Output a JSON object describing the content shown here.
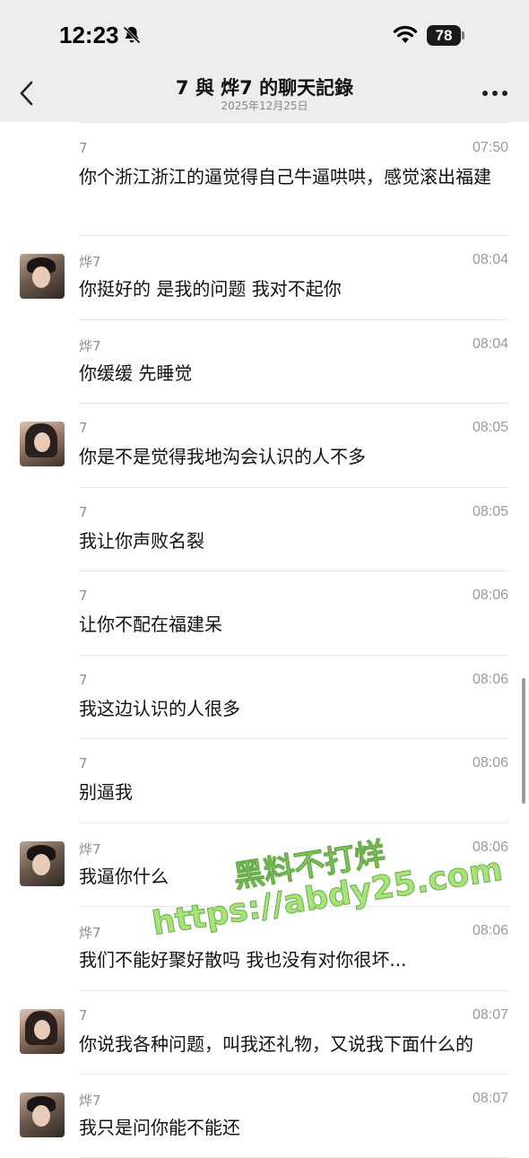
{
  "status_bar": {
    "time": "12:23",
    "battery": "78",
    "icons": [
      "bell-slash-icon",
      "wifi-icon",
      "battery-icon"
    ]
  },
  "header": {
    "title": "7 與 烨7 的聊天記錄",
    "date": "2025年12月25日",
    "icons": [
      "chevron-left-icon",
      "more-icon"
    ]
  },
  "messages": [
    {
      "sender": "7",
      "time": "07:50",
      "text": "你个浙江浙江的逼觉得自己牛逼哄哄，感觉滚出福建",
      "avatar": ""
    },
    {
      "sender": "烨7",
      "time": "08:04",
      "text": "你挺好的 是我的问题 我对不起你",
      "avatar": "male"
    },
    {
      "sender": "烨7",
      "time": "08:04",
      "text": "你缓缓 先睡觉",
      "avatar": ""
    },
    {
      "sender": "7",
      "time": "08:05",
      "text": "你是不是觉得我地沟会认识的人不多",
      "avatar": "female"
    },
    {
      "sender": "7",
      "time": "08:05",
      "text": "我让你声败名裂",
      "avatar": ""
    },
    {
      "sender": "7",
      "time": "08:06",
      "text": "让你不配在福建呆",
      "avatar": ""
    },
    {
      "sender": "7",
      "time": "08:06",
      "text": "我这边认识的人很多",
      "avatar": ""
    },
    {
      "sender": "7",
      "time": "08:06",
      "text": "别逼我",
      "avatar": ""
    },
    {
      "sender": "烨7",
      "time": "08:06",
      "text": "我逼你什么",
      "avatar": "male"
    },
    {
      "sender": "烨7",
      "time": "08:06",
      "text": "我们不能好聚好散吗 我也没有对你很坏...",
      "avatar": ""
    },
    {
      "sender": "7",
      "time": "08:07",
      "text": "你说我各种问题，叫我还礼物，又说我下面什么的",
      "avatar": "female"
    },
    {
      "sender": "烨7",
      "time": "08:07",
      "text": "我只是问你能不能还",
      "avatar": "male"
    }
  ],
  "watermark": {
    "line1": "黑料不打烊",
    "line2": "https://abdy25.com"
  },
  "colors": {
    "header_bg": "#ededed",
    "divider": "#e5e5e5",
    "meta_text": "#8e8e8e",
    "watermark": "#9ee06a"
  }
}
